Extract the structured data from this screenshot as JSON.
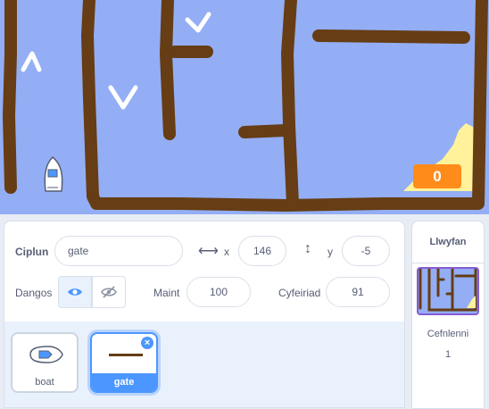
{
  "stage": {
    "score": "0"
  },
  "sprite_info": {
    "sprite_label": "Ciplun",
    "sprite_name": "gate",
    "x_label": "x",
    "x_value": "146",
    "y_label": "y",
    "y_value": "-5",
    "show_label": "Dangos",
    "size_label": "Maint",
    "size_value": "100",
    "direction_label": "Cyfeiriad",
    "direction_value": "91"
  },
  "sprites": [
    {
      "name": "boat",
      "selected": false
    },
    {
      "name": "gate",
      "selected": true
    }
  ],
  "stage_panel": {
    "title": "Llwyfan",
    "backdrops_label": "Cefnlenni",
    "backdrops_count": "1"
  },
  "colors": {
    "water": "#93aef4",
    "wall": "#663d14",
    "sand": "#fff29a",
    "score": "#ff8c1a",
    "accent": "#4c97ff",
    "stage_select": "#855cd6"
  },
  "icons": {
    "x_arrow": "left-right-arrow-icon",
    "y_arrow": "up-down-arrow-icon",
    "show": "eye-icon",
    "hide": "eye-slash-icon",
    "delete": "close-icon"
  }
}
